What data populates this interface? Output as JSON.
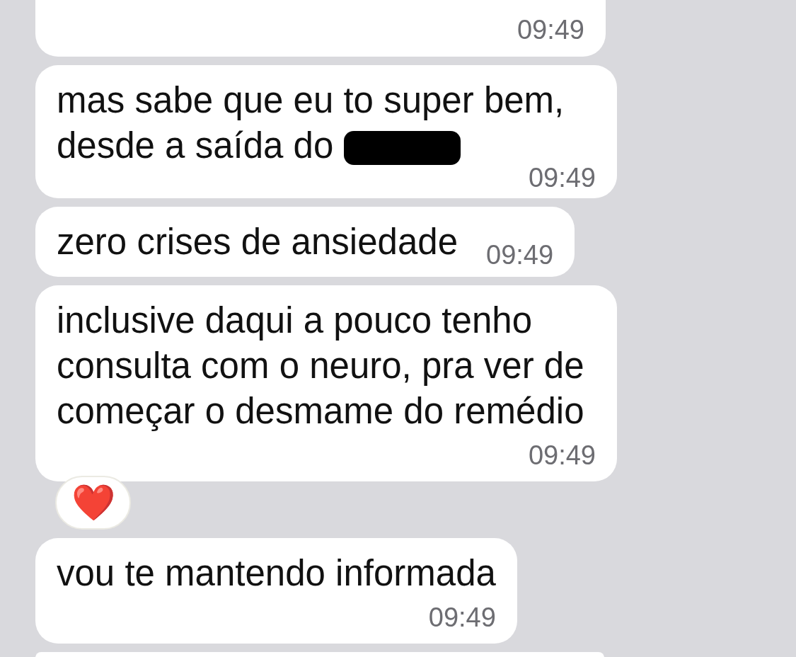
{
  "messages": [
    {
      "time": "09:49",
      "redacted": false
    },
    {
      "text": "mas sabe que eu to super bem, desde a saída do",
      "redacted": true,
      "time": "09:49"
    },
    {
      "text": "zero crises de ansiedade",
      "redacted": false,
      "time": "09:49"
    },
    {
      "text": "inclusive daqui a pouco tenho consulta com o neuro, pra ver de começar o desmame do remédio",
      "redacted": false,
      "time": "09:49",
      "reaction": "❤️"
    },
    {
      "text": "vou te mantendo informada",
      "redacted": false,
      "time": "09:49"
    }
  ]
}
